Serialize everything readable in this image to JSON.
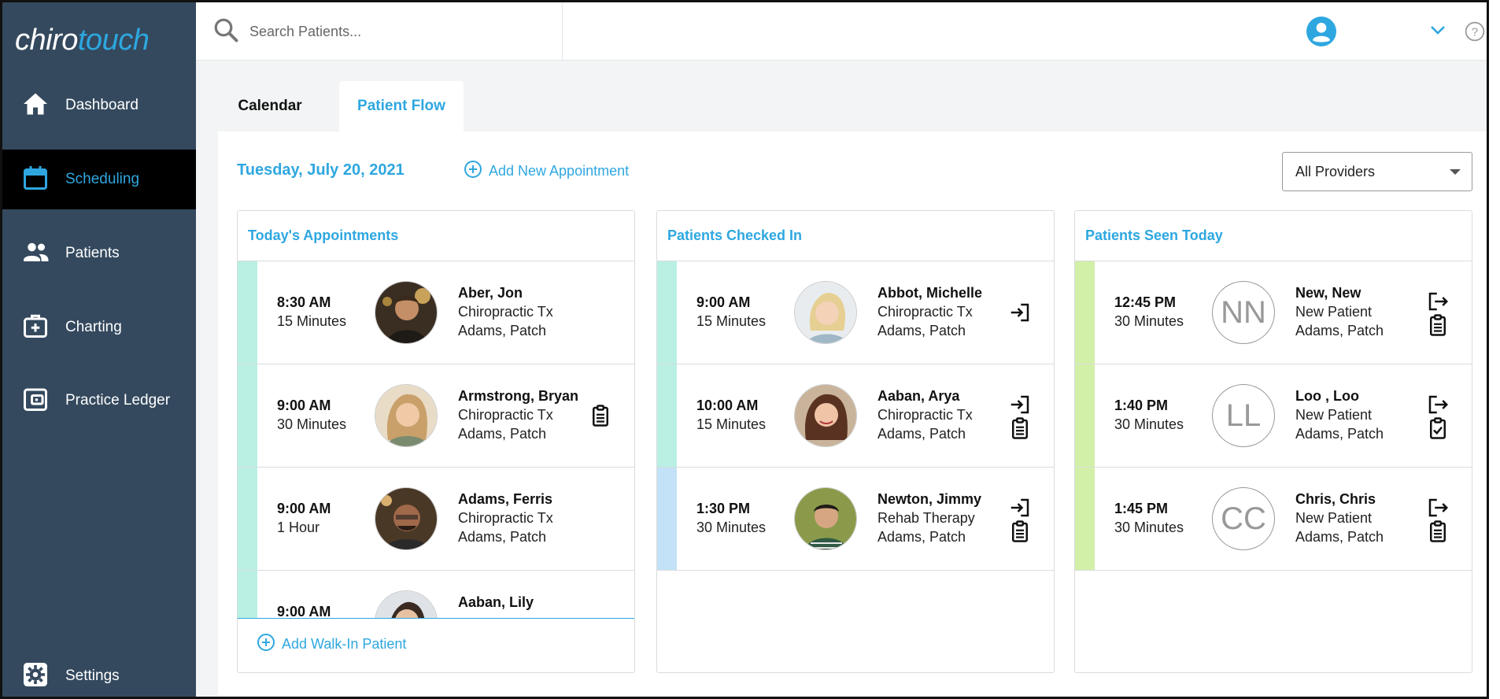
{
  "app": {
    "logo_part1": "chiro",
    "logo_part2": "touch"
  },
  "sidebar": {
    "items": [
      {
        "label": "Dashboard",
        "icon": "home-icon"
      },
      {
        "label": "Scheduling",
        "icon": "calendar-icon",
        "active": true
      },
      {
        "label": "Patients",
        "icon": "people-icon"
      },
      {
        "label": "Charting",
        "icon": "medkit-icon"
      },
      {
        "label": "Practice Ledger",
        "icon": "wallet-icon"
      },
      {
        "label": "Settings",
        "icon": "gear-icon"
      }
    ]
  },
  "topbar": {
    "search_placeholder": "Search Patients..."
  },
  "tabs": [
    {
      "label": "Calendar",
      "active": false
    },
    {
      "label": "Patient Flow",
      "active": true
    }
  ],
  "toolbar": {
    "date": "Tuesday, July 20, 2021",
    "add_appointment": "Add New Appointment",
    "provider_select": "All Providers"
  },
  "columns": {
    "today": {
      "title": "Today's Appointments",
      "add_walkin": "Add Walk-In Patient",
      "rows": [
        {
          "time": "8:30 AM",
          "duration": "15 Minutes",
          "name": "Aber, Jon",
          "type": "Chiropractic Tx",
          "provider": "Adams, Patch",
          "strip": "#b9f0e3"
        },
        {
          "time": "9:00 AM",
          "duration": "30 Minutes",
          "name": "Armstrong, Bryan",
          "type": "Chiropractic Tx",
          "provider": "Adams, Patch",
          "strip": "#b9f0e3"
        },
        {
          "time": "9:00 AM",
          "duration": "1 Hour",
          "name": "Adams, Ferris",
          "type": "Chiropractic Tx",
          "provider": "Adams, Patch",
          "strip": "#b9f0e3"
        },
        {
          "time": "9:00 AM",
          "duration": "",
          "name": "Aaban, Lily",
          "type": "",
          "provider": "",
          "strip": "#b9f0e3"
        }
      ]
    },
    "checked_in": {
      "title": "Patients Checked In",
      "rows": [
        {
          "time": "9:00 AM",
          "duration": "15 Minutes",
          "name": "Abbot, Michelle",
          "type": "Chiropractic Tx",
          "provider": "Adams, Patch",
          "strip": "#b9f0e3"
        },
        {
          "time": "10:00 AM",
          "duration": "15 Minutes",
          "name": "Aaban, Arya",
          "type": "Chiropractic Tx",
          "provider": "Adams, Patch",
          "strip": "#b9f0e3"
        },
        {
          "time": "1:30 PM",
          "duration": "30 Minutes",
          "name": "Newton, Jimmy",
          "type": "Rehab Therapy",
          "provider": "Adams, Patch",
          "strip": "#c3e2f7"
        }
      ]
    },
    "seen": {
      "title": "Patients Seen Today",
      "rows": [
        {
          "time": "12:45 PM",
          "duration": "30 Minutes",
          "initials": "NN",
          "name": "New, New",
          "type": "New Patient",
          "provider": "Adams, Patch",
          "strip": "#d2f0a8"
        },
        {
          "time": "1:40 PM",
          "duration": "30 Minutes",
          "initials": "LL",
          "name": "Loo , Loo",
          "type": "New Patient",
          "provider": "Adams, Patch",
          "strip": "#d2f0a8"
        },
        {
          "time": "1:45 PM",
          "duration": "30 Minutes",
          "initials": "CC",
          "name": "Chris, Chris",
          "type": "New Patient",
          "provider": "Adams, Patch",
          "strip": "#d2f0a8"
        }
      ]
    }
  },
  "colors": {
    "accent": "#2ea7e0",
    "sidebar": "#34495e",
    "active_nav": "#000000"
  }
}
